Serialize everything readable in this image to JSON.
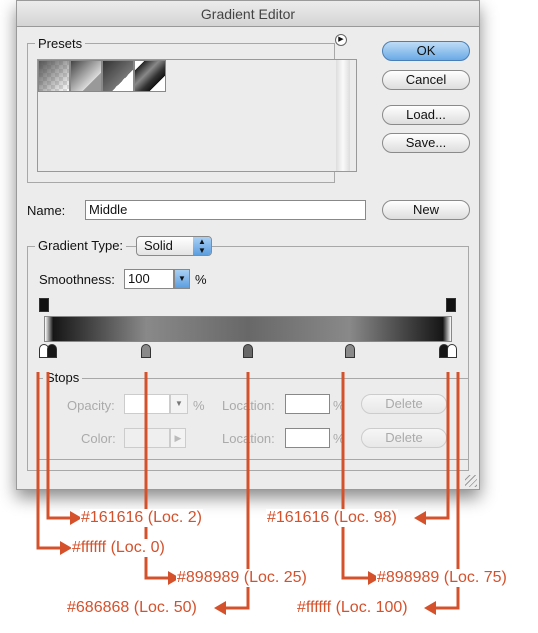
{
  "window": {
    "title": "Gradient Editor"
  },
  "presets": {
    "label": "Presets",
    "menu_icon": "triangle-right-circle-icon"
  },
  "buttons": {
    "ok": "OK",
    "cancel": "Cancel",
    "load": "Load...",
    "save": "Save...",
    "new": "New"
  },
  "name": {
    "label": "Name:",
    "value": "Middle"
  },
  "gradient_type": {
    "label": "Gradient Type:",
    "value": "Solid"
  },
  "smoothness": {
    "label": "Smoothness:",
    "value": "100",
    "unit": "%"
  },
  "stops": {
    "label": "Stops",
    "opacity_label": "Opacity:",
    "opacity_unit": "%",
    "color_label": "Color:",
    "location_label": "Location:",
    "location_unit": "%",
    "delete_label": "Delete"
  },
  "gradient_stops": [
    {
      "color": "#ffffff",
      "location": 0
    },
    {
      "color": "#161616",
      "location": 2
    },
    {
      "color": "#898989",
      "location": 25
    },
    {
      "color": "#686868",
      "location": 50
    },
    {
      "color": "#898989",
      "location": 75
    },
    {
      "color": "#161616",
      "location": 98
    },
    {
      "color": "#ffffff",
      "location": 100
    }
  ],
  "annotations": {
    "a0": "#ffffff (Loc. 0)",
    "a2": "#161616 (Loc. 2)",
    "a25": "#898989 (Loc. 25)",
    "a50": "#686868 (Loc. 50)",
    "a75": "#898989 (Loc. 75)",
    "a98": "#161616 (Loc. 98)",
    "a100": "#ffffff (Loc. 100)"
  },
  "colors": {
    "accent": "#d4512c",
    "ok_button": "#6aaae6"
  }
}
